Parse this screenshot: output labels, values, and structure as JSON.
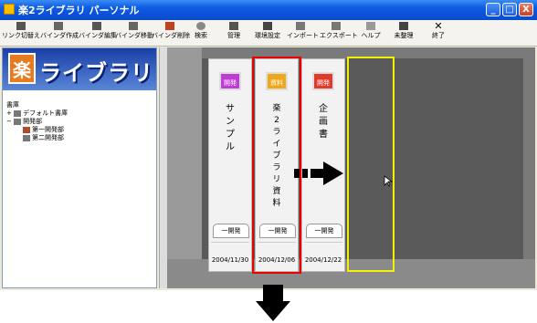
{
  "window": {
    "title": "楽2ライブラリ パーソナル",
    "controls": [
      "_",
      "□",
      "X"
    ]
  },
  "toolbar": [
    {
      "label": "リンク切替え",
      "icon": "link-switch-icon"
    },
    {
      "label": "バインダ作成",
      "icon": "binder-create-icon"
    },
    {
      "label": "バインダ編集",
      "icon": "binder-edit-icon"
    },
    {
      "label": "バインダ移動",
      "icon": "binder-move-icon"
    },
    {
      "label": "バインダ削除",
      "icon": "binder-delete-icon"
    },
    {
      "label": "検索",
      "icon": "search-icon"
    },
    {
      "label": "管理",
      "icon": "manage-icon"
    },
    {
      "label": "環境設定",
      "icon": "settings-icon"
    },
    {
      "label": "インポート",
      "icon": "import-icon"
    },
    {
      "label": "エクスポート",
      "icon": "export-icon"
    },
    {
      "label": "ヘルプ",
      "icon": "help-icon"
    },
    {
      "label": "未整理",
      "icon": "unsorted-icon"
    },
    {
      "label": "終了",
      "icon": "exit-icon"
    }
  ],
  "logo": {
    "mark": "楽",
    "text": "ライブラリ"
  },
  "tree": {
    "root": "書庫",
    "items": [
      {
        "label": "デフォルト書庫",
        "toggle": "+"
      },
      {
        "label": "開発部",
        "toggle": "−"
      }
    ],
    "children": [
      {
        "label": "第一開発部"
      },
      {
        "label": "第二開発部"
      }
    ]
  },
  "books": [
    {
      "tag": "開発",
      "tag_color": "#c03cd6",
      "title_chars": [
        "サ",
        "ン",
        "プ",
        "ル"
      ],
      "division": "一開発",
      "date": "2004/11/30"
    },
    {
      "tag": "資料",
      "tag_color": "#f0a818",
      "title_chars": [
        "楽",
        "2",
        "ラ",
        "イ",
        "ブ",
        "ラ",
        "リ",
        "資",
        "料"
      ],
      "division": "一開発",
      "date": "2004/12/06"
    },
    {
      "tag": "開発",
      "tag_color": "#e23a2a",
      "title_chars": [
        "企",
        "画",
        "書"
      ],
      "division": "一開発",
      "date": "2004/12/22"
    }
  ]
}
